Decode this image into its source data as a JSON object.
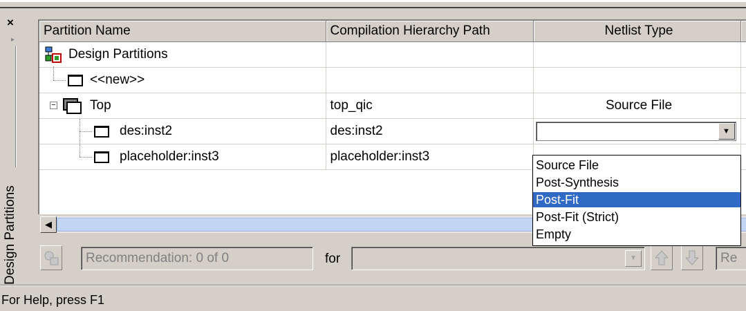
{
  "dock": {
    "title": "Design Partitions",
    "close_glyph": "×",
    "arrow_glyph": "▸"
  },
  "grid": {
    "columns": [
      "Partition Name",
      "Compilation Hierarchy Path",
      "Netlist Type"
    ],
    "rows": [
      {
        "name": "Design Partitions",
        "path": "",
        "netlist": ""
      },
      {
        "name": "<<new>>",
        "path": "",
        "netlist": ""
      },
      {
        "name": "Top",
        "path": "top_qic",
        "netlist": "Source File"
      },
      {
        "name": "des:inst2",
        "path": "des:inst2",
        "netlist": ""
      },
      {
        "name": "placeholder:inst3",
        "path": "placeholder:inst3",
        "netlist": ""
      }
    ],
    "tree_toggle": "−"
  },
  "dropdown": {
    "options": [
      "Source File",
      "Post-Synthesis",
      "Post-Fit",
      "Post-Fit (Strict)",
      "Empty"
    ],
    "selected": "Post-Fit"
  },
  "toolbar": {
    "recommendation_value": "Recommendation: 0 of 0",
    "for_label": "for",
    "for_value": "",
    "right_field_value": "Re"
  },
  "status": {
    "text": "For Help, press F1"
  },
  "colors": {
    "selection": "#316ac5",
    "chrome": "#d4d0c8"
  }
}
